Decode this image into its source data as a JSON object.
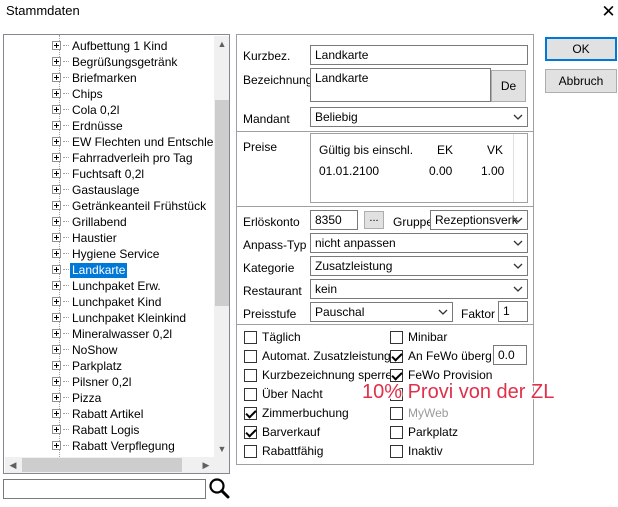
{
  "window": {
    "title": "Stammdaten",
    "close": "✕"
  },
  "tree": {
    "items": [
      "Aufbettung 1 Kind",
      "Begrüßungsgetränk",
      "Briefmarken",
      "Chips",
      "Cola 0,2l",
      "Erdnüsse",
      "EW Flechten und Entschleuni",
      "Fahrradverleih pro Tag",
      "Fuchtsaft 0,2l",
      "Gastauslage",
      "Getränkeanteil Frühstück",
      "Grillabend",
      "Haustier",
      "Hygiene Service",
      "Landkarte",
      "Lunchpaket Erw.",
      "Lunchpaket Kind",
      "Lunchpaket Kleinkind",
      "Mineralwasser 0,2l",
      "NoShow",
      "Parkplatz",
      "Pilsner 0,2l",
      "Pizza",
      "Rabatt Artikel",
      "Rabatt Logis",
      "Rabatt Verpflegung"
    ],
    "selected_index": 14
  },
  "search": {
    "value": "",
    "icon": "search-icon"
  },
  "form": {
    "kurzbez_label": "Kurzbez.",
    "kurzbez_value": "Landkarte",
    "bezeichnung_label": "Bezeichnung",
    "bezeichnung_value": "Landkarte",
    "lang_button": "De",
    "mandant_label": "Mandant",
    "mandant_value": "Beliebig",
    "preise_label": "Preise",
    "preise_headers": [
      "Gültig bis einschl.",
      "EK",
      "VK"
    ],
    "preise_rows": [
      [
        "01.01.2100",
        "0.00",
        "1.00"
      ]
    ],
    "erloeskonto_label": "Erlöskonto",
    "erloeskonto_value": "8350",
    "erloeskonto_button": "...",
    "gruppe_label": "Gruppe",
    "gruppe_value": "Rezeptionsverk",
    "anpass_label": "Anpass-Typ",
    "anpass_value": "nicht anpassen",
    "kategorie_label": "Kategorie",
    "kategorie_value": "Zusatzleistung",
    "restaurant_label": "Restaurant",
    "restaurant_value": "kein",
    "preisstufe_label": "Preisstufe",
    "preisstufe_value": "Pauschal",
    "faktor_label": "Faktor",
    "faktor_value": "1"
  },
  "checkboxes": {
    "left": [
      {
        "label": "Täglich",
        "checked": false
      },
      {
        "label": "Automat. Zusatzleistung",
        "checked": false
      },
      {
        "label": "Kurzbezeichnung sperren",
        "checked": false
      },
      {
        "label": "Über Nacht",
        "checked": false
      },
      {
        "label": "Zimmerbuchung",
        "checked": true
      },
      {
        "label": "Barverkauf",
        "checked": true
      },
      {
        "label": "Rabattfähig",
        "checked": false
      }
    ],
    "right": [
      {
        "label": "Minibar",
        "checked": false
      },
      {
        "label": "An FeWo überg.",
        "checked": true
      },
      {
        "label": "FeWo Provision",
        "checked": true
      },
      {
        "label": "",
        "checked": false
      },
      {
        "label": "MyWeb",
        "checked": false
      },
      {
        "label": "Parkplatz",
        "checked": false
      },
      {
        "label": "Inaktiv",
        "checked": false
      }
    ],
    "fewo_value": "0.0"
  },
  "annotation": "10% Provi von der ZL",
  "buttons": {
    "ok": "OK",
    "cancel": "Abbruch"
  },
  "colors": {
    "selection": "#0078d7",
    "annotation": "#e0304a",
    "default_button_border": "#0078d7"
  }
}
